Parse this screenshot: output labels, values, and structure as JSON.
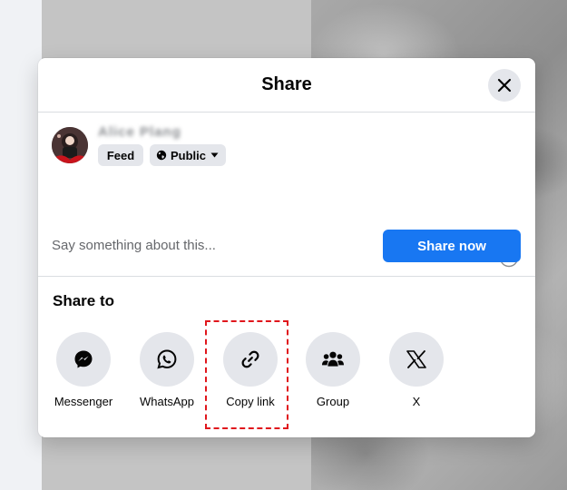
{
  "dialog": {
    "title": "Share",
    "close_icon": "close-icon"
  },
  "composer": {
    "user_name": "Alice Plang",
    "audience_feed": "Feed",
    "audience_privacy": "Public",
    "placeholder": "Say something about this...",
    "share_button": "Share now"
  },
  "share_to": {
    "title": "Share to",
    "options": [
      {
        "label": "Messenger",
        "icon": "messenger-icon"
      },
      {
        "label": "WhatsApp",
        "icon": "whatsapp-icon"
      },
      {
        "label": "Copy link",
        "icon": "link-icon"
      },
      {
        "label": "Group",
        "icon": "group-icon"
      },
      {
        "label": "X",
        "icon": "x-logo-icon"
      }
    ]
  },
  "colors": {
    "accent": "#1877f2",
    "highlight": "#e0161c",
    "chip_bg": "#e4e6eb"
  }
}
